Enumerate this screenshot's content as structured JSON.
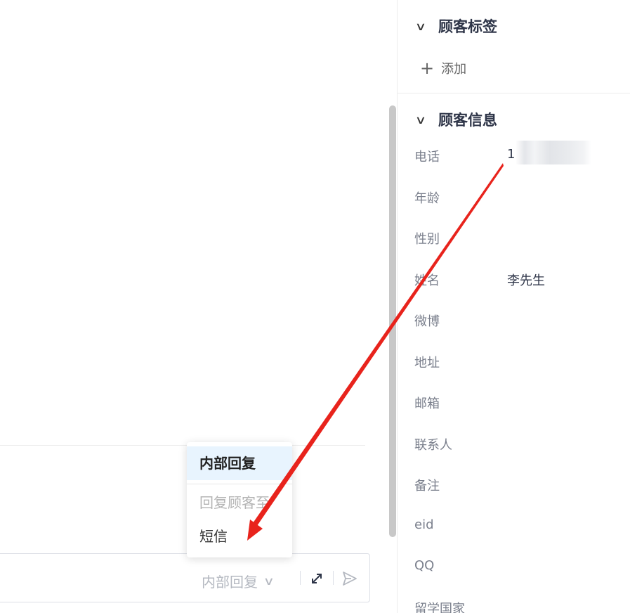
{
  "composer": {
    "reply_mode_label": "内部回复"
  },
  "reply_menu": {
    "items": [
      {
        "label": "内部回复",
        "state": "selected"
      },
      {
        "label": "回复顾客至",
        "state": "disabled"
      },
      {
        "label": "短信",
        "state": "normal"
      }
    ]
  },
  "customer_panel": {
    "tags_section": {
      "title": "顾客标签",
      "add_label": "添加"
    },
    "info_section": {
      "title": "顾客信息",
      "fields": [
        {
          "label": "电话",
          "value": "1"
        },
        {
          "label": "年龄",
          "value": ""
        },
        {
          "label": "性别",
          "value": ""
        },
        {
          "label": "姓名",
          "value": "李先生"
        },
        {
          "label": "微博",
          "value": ""
        },
        {
          "label": "地址",
          "value": ""
        },
        {
          "label": "邮箱",
          "value": ""
        },
        {
          "label": "联系人",
          "value": ""
        },
        {
          "label": "备注",
          "value": ""
        },
        {
          "label": "eid",
          "value": ""
        },
        {
          "label": "QQ",
          "value": ""
        },
        {
          "label": "留学国家",
          "value": ""
        }
      ]
    }
  },
  "colors": {
    "annotation_arrow": "#e8231c",
    "menu_highlight": "#e8f4fe",
    "heading": "#2e3548"
  },
  "icons": [
    "chevron-down-icon",
    "plus-icon",
    "expand-icon",
    "send-icon"
  ]
}
